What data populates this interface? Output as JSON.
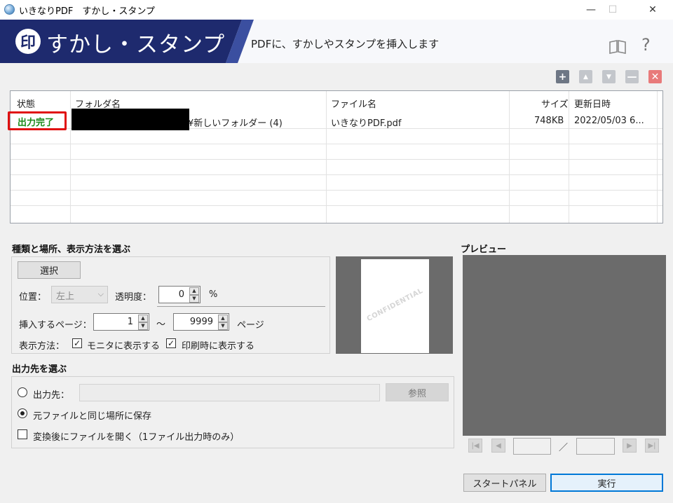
{
  "window": {
    "title": "いきなりPDF　すかし・スタンプ",
    "minimize": "—",
    "maximize": "☐",
    "close": "✕"
  },
  "banner": {
    "logo_char": "印",
    "title": "すかし・スタンプ",
    "description": "PDFに、すかしやスタンプを挿入します",
    "help": "?"
  },
  "toolbar": {
    "add": "+",
    "up": "▲",
    "down": "▼",
    "remove": "—",
    "delete": "✕"
  },
  "table": {
    "headers": [
      "状態",
      "フォルダ名",
      "ファイル名",
      "サイズ",
      "更新日時"
    ],
    "rows": [
      {
        "status": "出力完了",
        "folder": "¥新しいフォルダー (4)",
        "file": "いきなりPDF.pdf",
        "size": "748KB",
        "date": "2022/05/03 6..."
      }
    ]
  },
  "section1": {
    "title": "種類と場所、表示方法を選ぶ",
    "select_button": "選択",
    "position_label": "位置：",
    "position_value": "左上",
    "opacity_label": "透明度：",
    "opacity_value": "0",
    "opacity_unit": "%",
    "pages_label": "挿入するページ：",
    "page_from": "1",
    "page_sep": "～",
    "page_to": "9999",
    "page_unit": "ページ",
    "display_label": "表示方法：",
    "show_monitor": "モニタに表示する",
    "show_print": "印刷時に表示する"
  },
  "stamp_preview": {
    "stamp_text": "CONFIDENTIAL"
  },
  "section2": {
    "title": "出力先を選ぶ",
    "dest_label": "出力先：",
    "browse_button": "参照",
    "same_location": "元ファイルと同じ場所に保存",
    "open_after": "変換後にファイルを開く（1ファイル出力時のみ）"
  },
  "preview": {
    "title": "プレビュー",
    "page_sep": "／"
  },
  "buttons": {
    "start_panel": "スタートパネル",
    "run": "実行"
  },
  "colors": {
    "banner_dark": "#1e2a6e",
    "status_green": "#1a8a1a",
    "highlight_red": "#e01010",
    "accent_blue": "#0078d7"
  }
}
